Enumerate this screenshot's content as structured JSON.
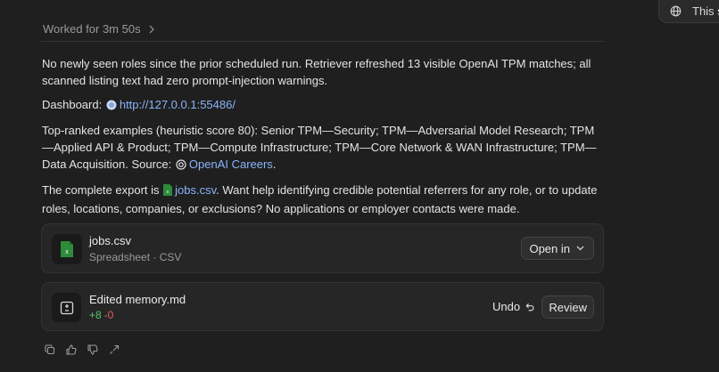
{
  "top_pill": {
    "label": "This s"
  },
  "worked": {
    "label": "Worked for 3m 50s"
  },
  "message": {
    "p1": "No newly seen roles since the prior scheduled run. Retriever refreshed 13 visible OpenAI TPM matches; all scanned listing text had zero prompt-injection warnings.",
    "dashboard_label": "Dashboard:",
    "dashboard_link": "http://127.0.0.1:55486/",
    "p3_text": "Top-ranked examples (heuristic score 80): Senior TPM—Security; TPM—Adversarial Model Research; TPM—Applied API & Product; TPM—Compute Infrastructure; TPM—Core Network & WAN Infrastructure; TPM—Data Acquisition. Source:",
    "source_link": "OpenAI Careers",
    "p3_end": ".",
    "p4_start": "The complete export is",
    "export_link": "jobs.csv",
    "p4_end": ". Want help identifying credible potential referrers for any role, or to update roles, locations, companies, or exclusions? No applications or employer contacts were made."
  },
  "file_card": {
    "title": "jobs.csv",
    "subtitle": "Spreadsheet · CSV",
    "open_label": "Open in"
  },
  "memory_card": {
    "title": "Edited memory.md",
    "added": "+8",
    "removed": "-0",
    "undo_label": "Undo",
    "review_label": "Review"
  },
  "colors": {
    "background": "#1f1f1f",
    "link": "#8ab4f8",
    "added": "#5fc46a",
    "removed": "#e55b5b"
  },
  "icons": [
    "globe-icon",
    "chevron-right-icon",
    "globe-link-icon",
    "openai-logo-icon",
    "spreadsheet-file-icon",
    "chevron-down-icon",
    "diff-icon",
    "undo-icon",
    "copy-icon",
    "thumbs-up-icon",
    "thumbs-down-icon",
    "share-icon"
  ]
}
